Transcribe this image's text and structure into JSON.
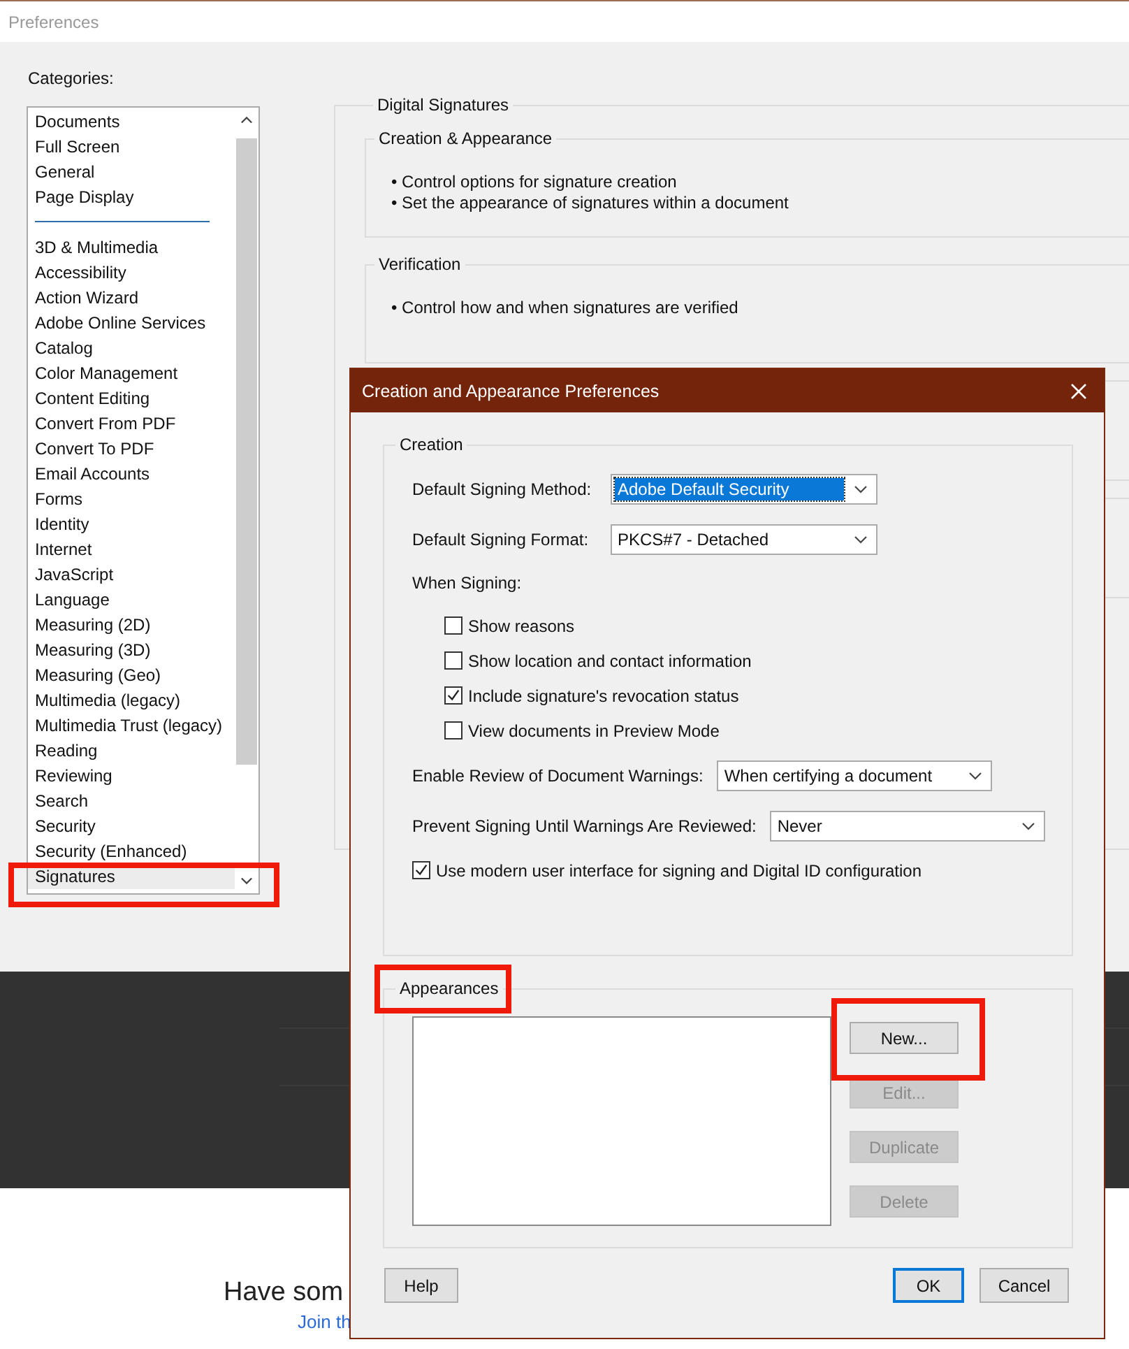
{
  "window": {
    "title": "Preferences"
  },
  "categories": {
    "label": "Categories:",
    "groups": [
      {
        "items": [
          {
            "label": "Documents",
            "selected": false
          },
          {
            "label": "Full Screen",
            "selected": false
          },
          {
            "label": "General",
            "selected": false
          },
          {
            "label": "Page Display",
            "selected": false
          }
        ]
      },
      {
        "items": [
          {
            "label": "3D & Multimedia",
            "selected": false
          },
          {
            "label": "Accessibility",
            "selected": false
          },
          {
            "label": "Action Wizard",
            "selected": false
          },
          {
            "label": "Adobe Online Services",
            "selected": false
          },
          {
            "label": "Catalog",
            "selected": false
          },
          {
            "label": "Color Management",
            "selected": false
          },
          {
            "label": "Content Editing",
            "selected": false
          },
          {
            "label": "Convert From PDF",
            "selected": false
          },
          {
            "label": "Convert To PDF",
            "selected": false
          },
          {
            "label": "Email Accounts",
            "selected": false
          },
          {
            "label": "Forms",
            "selected": false
          },
          {
            "label": "Identity",
            "selected": false
          },
          {
            "label": "Internet",
            "selected": false
          },
          {
            "label": "JavaScript",
            "selected": false
          },
          {
            "label": "Language",
            "selected": false
          },
          {
            "label": "Measuring (2D)",
            "selected": false
          },
          {
            "label": "Measuring (3D)",
            "selected": false
          },
          {
            "label": "Measuring (Geo)",
            "selected": false
          },
          {
            "label": "Multimedia (legacy)",
            "selected": false
          },
          {
            "label": "Multimedia Trust (legacy)",
            "selected": false
          },
          {
            "label": "Reading",
            "selected": false
          },
          {
            "label": "Reviewing",
            "selected": false
          },
          {
            "label": "Search",
            "selected": false
          },
          {
            "label": "Security",
            "selected": false
          },
          {
            "label": "Security (Enhanced)",
            "selected": false
          },
          {
            "label": "Signatures",
            "selected": true
          }
        ]
      }
    ]
  },
  "panel": {
    "title": "Digital Signatures",
    "sections": [
      {
        "title": "Creation & Appearance",
        "bullets": [
          "• Control options for signature creation",
          "• Set the appearance of signatures within a document"
        ]
      },
      {
        "title": "Verification",
        "bullets": [
          "• Control how and when signatures are verified"
        ]
      }
    ]
  },
  "background": {
    "heading": "Have som",
    "link": "Join th"
  },
  "dialog": {
    "title": "Creation and Appearance Preferences",
    "creation": {
      "title": "Creation",
      "fields": [
        {
          "label": "Default Signing Method:",
          "value": "Adobe Default Security",
          "focused": true
        },
        {
          "label": "Default Signing Format:",
          "value": "PKCS#7 - Detached",
          "focused": false
        }
      ],
      "when_signing": "When Signing:",
      "options": [
        {
          "label": "Show reasons",
          "checked": false
        },
        {
          "label": "Show location and contact information",
          "checked": false
        },
        {
          "label": "Include signature's revocation status",
          "checked": true
        },
        {
          "label": "View documents in Preview Mode",
          "checked": false
        }
      ],
      "selects": [
        {
          "label": "Enable Review of Document Warnings:",
          "value": "When certifying a document"
        },
        {
          "label": "Prevent Signing Until Warnings Are Reviewed:",
          "value": "Never"
        }
      ],
      "modern_ui": {
        "label": "Use modern user interface for signing and Digital ID configuration",
        "checked": true
      }
    },
    "appearances": {
      "title": "Appearances",
      "buttons": [
        {
          "label": "New...",
          "disabled": false
        },
        {
          "label": "Edit...",
          "disabled": true
        },
        {
          "label": "Duplicate",
          "disabled": true
        },
        {
          "label": "Delete",
          "disabled": true
        }
      ]
    },
    "footer": [
      {
        "label": "Help",
        "default": false
      },
      {
        "label": "OK",
        "default": true
      },
      {
        "label": "Cancel",
        "default": false
      }
    ]
  }
}
